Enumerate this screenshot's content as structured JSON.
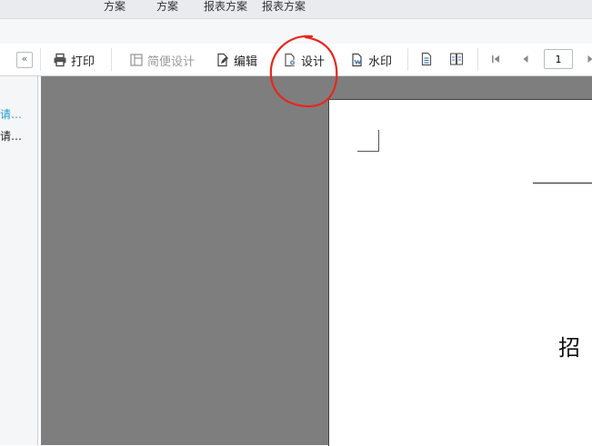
{
  "menu": {
    "tabs": [
      "方案",
      "方案",
      "报表方案",
      "报表方案"
    ]
  },
  "sidebar": {
    "collapse_label": "«",
    "items": [
      {
        "label": "请…",
        "color": "#1e9fd1"
      },
      {
        "label": "请…",
        "color": "#222222"
      }
    ]
  },
  "toolbar": {
    "print_label": "打印",
    "simple_design_label": "简便设计",
    "edit_label": "编辑",
    "design_label": "设计",
    "watermark_label": "水印",
    "page_number": "1"
  },
  "preview": {
    "heading_char": "招"
  },
  "colors": {
    "accent_link": "#1e9fd1",
    "annotation_circle": "#e8261c",
    "preview_background": "#7e7e7e"
  }
}
